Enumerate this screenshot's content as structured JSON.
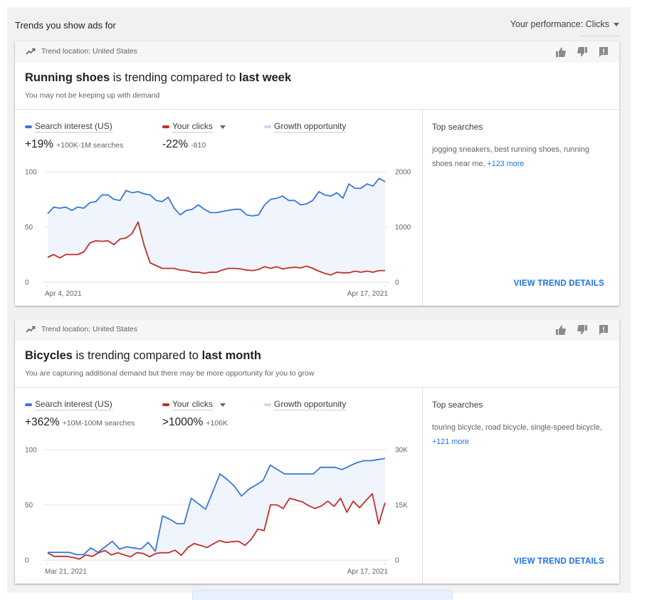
{
  "header": {
    "title": "Trends you show ads for",
    "performance_select": "Your performance: Clicks"
  },
  "colors": {
    "search_interest": "#3a78d8",
    "your_clicks": "#c0302a",
    "growth_opportunity": "#c9d9f6",
    "link": "#1a73e8"
  },
  "legend_labels": {
    "search_interest": "Search interest (US)",
    "your_clicks": "Your clicks",
    "growth_opportunity": "Growth opportunity"
  },
  "cards": [
    {
      "location": "Trend location: United States",
      "headline_term": "Running shoes",
      "headline_mid": " is trending compared to ",
      "headline_period": "last week",
      "subline": "You may not be keeping up with demand",
      "search_stat": "+19%",
      "search_stat_detail": "+100K-1M searches",
      "clicks_stat": "-22%",
      "clicks_stat_detail": "-810",
      "top_searches_title": "Top searches",
      "top_searches": "jogging sneakers, best running shoes, running shoes near me,",
      "top_searches_more": "+123 more",
      "view_details": "VIEW TREND DETAILS"
    },
    {
      "location": "Trend location: United States",
      "headline_term": "Bicycles",
      "headline_mid": " is trending compared to ",
      "headline_period": "last month",
      "subline": "You are capturing additional demand but there may be more opportunity for you to grow",
      "search_stat": "+362%",
      "search_stat_detail": "+10M-100M searches",
      "clicks_stat": ">1000%",
      "clicks_stat_detail": "+106K",
      "top_searches_title": "Top searches",
      "top_searches": "touring bicycle, road bicycle, single-speed bicycle,",
      "top_searches_more": "+121 more",
      "view_details": "VIEW TREND DETAILS"
    }
  ],
  "chart_data": [
    {
      "type": "line",
      "title": "Running shoes",
      "x_start_label": "Apr 4, 2021",
      "x_end_label": "Apr 17, 2021",
      "left_axis": {
        "ticks": [
          "0",
          "50",
          "100"
        ],
        "range": [
          0,
          100
        ]
      },
      "right_axis": {
        "ticks": [
          "0",
          "1000",
          "2000"
        ],
        "range": [
          0,
          2000
        ]
      },
      "grid": true,
      "fill_between": "Growth opportunity",
      "series": [
        {
          "name": "Search interest (US)",
          "axis": "left",
          "values": [
            62,
            68,
            67,
            68,
            65,
            68,
            67,
            72,
            73,
            79,
            79,
            75,
            74,
            83,
            81,
            82,
            80,
            79,
            74,
            73,
            77,
            67,
            61,
            65,
            66,
            70,
            66,
            63,
            63,
            64,
            65,
            66,
            66,
            61,
            60,
            61,
            70,
            75,
            76,
            78,
            74,
            74,
            70,
            71,
            74,
            82,
            79,
            78,
            81,
            76,
            89,
            85,
            85,
            89,
            87,
            94,
            91
          ]
        },
        {
          "name": "Your clicks",
          "axis": "right",
          "values": [
            450,
            500,
            440,
            500,
            500,
            500,
            550,
            710,
            750,
            740,
            750,
            680,
            780,
            800,
            880,
            1090,
            670,
            350,
            300,
            250,
            250,
            250,
            220,
            210,
            180,
            180,
            160,
            180,
            180,
            220,
            250,
            250,
            240,
            220,
            210,
            230,
            280,
            250,
            280,
            240,
            260,
            270,
            260,
            290,
            250,
            200,
            160,
            130,
            180,
            170,
            170,
            200,
            180,
            200,
            180,
            210,
            210
          ]
        }
      ]
    },
    {
      "type": "line",
      "title": "Bicycles",
      "x_start_label": "Mar 21, 2021",
      "x_end_label": "Apr 17, 2021",
      "left_axis": {
        "ticks": [
          "0",
          "50",
          "100"
        ],
        "range": [
          0,
          100
        ]
      },
      "right_axis": {
        "ticks": [
          "0",
          "15K",
          "30K"
        ],
        "range": [
          0,
          30000
        ]
      },
      "grid": true,
      "fill_between": "Growth opportunity",
      "series": [
        {
          "name": "Search interest (US)",
          "axis": "left",
          "values": [
            7,
            7,
            7,
            7,
            5,
            5,
            11,
            7,
            12,
            17,
            10,
            12,
            11,
            10,
            16,
            8,
            40,
            37,
            33,
            33,
            56,
            51,
            46,
            62,
            78,
            73,
            67,
            58,
            64,
            68,
            72,
            86,
            82,
            78,
            78,
            78,
            78,
            78,
            84,
            84,
            84,
            82,
            85,
            88,
            90,
            90,
            91,
            92
          ]
        },
        {
          "name": "Your clicks",
          "axis": "right",
          "values": [
            2000,
            1000,
            1000,
            1000,
            700,
            300,
            1400,
            1000,
            2000,
            2600,
            1400,
            2000,
            1400,
            900,
            2000,
            1800,
            900,
            1800,
            2000,
            2000,
            2700,
            1300,
            3400,
            4500,
            4000,
            3400,
            4400,
            5300,
            4800,
            5000,
            5100,
            4000,
            5700,
            8400,
            8000,
            15000,
            15000,
            14000,
            16800,
            16300,
            15800,
            14800,
            14000,
            14700,
            16000,
            14600,
            16800,
            13000,
            16000,
            14200,
            16200,
            18000,
            9800,
            15600
          ]
        }
      ]
    }
  ]
}
